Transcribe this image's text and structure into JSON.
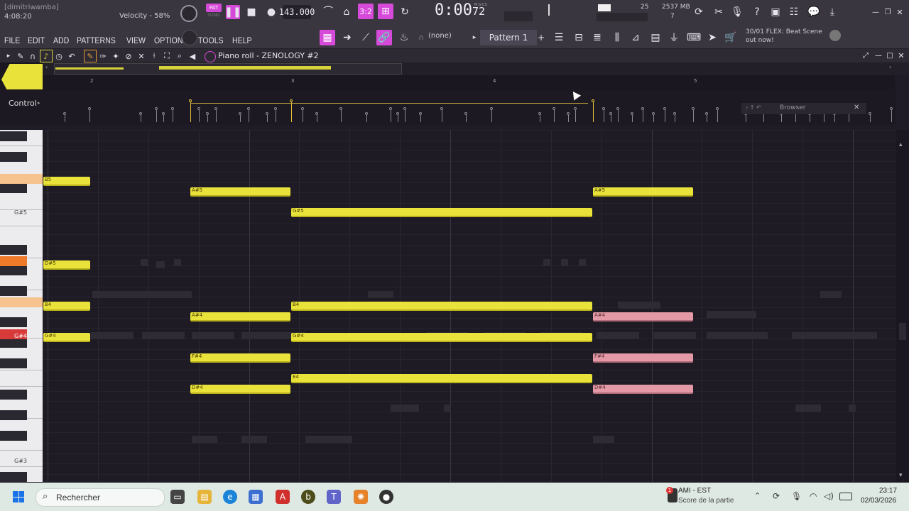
{
  "top": {
    "user": "[dimitriwamba]",
    "song_pos": "4:08:20",
    "velocity": "Velocity - 58%",
    "pat_label": "PAT",
    "song_label": "SONG",
    "tempo": "143.000",
    "time_main": "0:00",
    "time_sub": "72",
    "time_unit": "M:S:CS",
    "cpu": "25",
    "mem": "2537 MB",
    "voices": "7",
    "hint_line1": "30/01  FLEX: Beat Scene",
    "hint_line2": "out now!"
  },
  "menu": {
    "items": [
      "FILE",
      "EDIT",
      "ADD",
      "PATTERNS",
      "VIEW",
      "OPTIONS",
      "TOOLS",
      "HELP"
    ],
    "snap": "(none)",
    "pattern": "Pattern 1"
  },
  "pianoroll": {
    "title": "Piano roll - ZENOLOGY #2",
    "control_label": "Control",
    "browser_label": "Browser",
    "bars": [
      "2",
      "3",
      "4",
      "5"
    ],
    "key_labels": [
      "G#5",
      "G#4",
      "G#3"
    ]
  },
  "notes": [
    {
      "label": "B5",
      "row": "b5"
    },
    {
      "label": "A#5",
      "row": "as5"
    },
    {
      "label": "G#5",
      "row": "gs5"
    },
    {
      "label": "D#5",
      "row": "ds5"
    },
    {
      "label": "B4",
      "row": "b4"
    },
    {
      "label": "A#4",
      "row": "as4"
    },
    {
      "label": "G#4",
      "row": "gs4"
    },
    {
      "label": "F#4",
      "row": "fs4"
    },
    {
      "label": "E4",
      "row": "e4"
    },
    {
      "label": "D#4",
      "row": "ds4"
    }
  ],
  "taskbar": {
    "search": "Rechercher",
    "notif_title": "AMI - EST",
    "notif_sub": "Score de la partie",
    "notif_badge": "1",
    "clock_time": "23:17",
    "clock_date": "02/03/2026"
  },
  "colors": {
    "note_yellow": "#e8e23a",
    "note_pink": "#e39aa6",
    "accent_pink": "#d54ad8"
  }
}
